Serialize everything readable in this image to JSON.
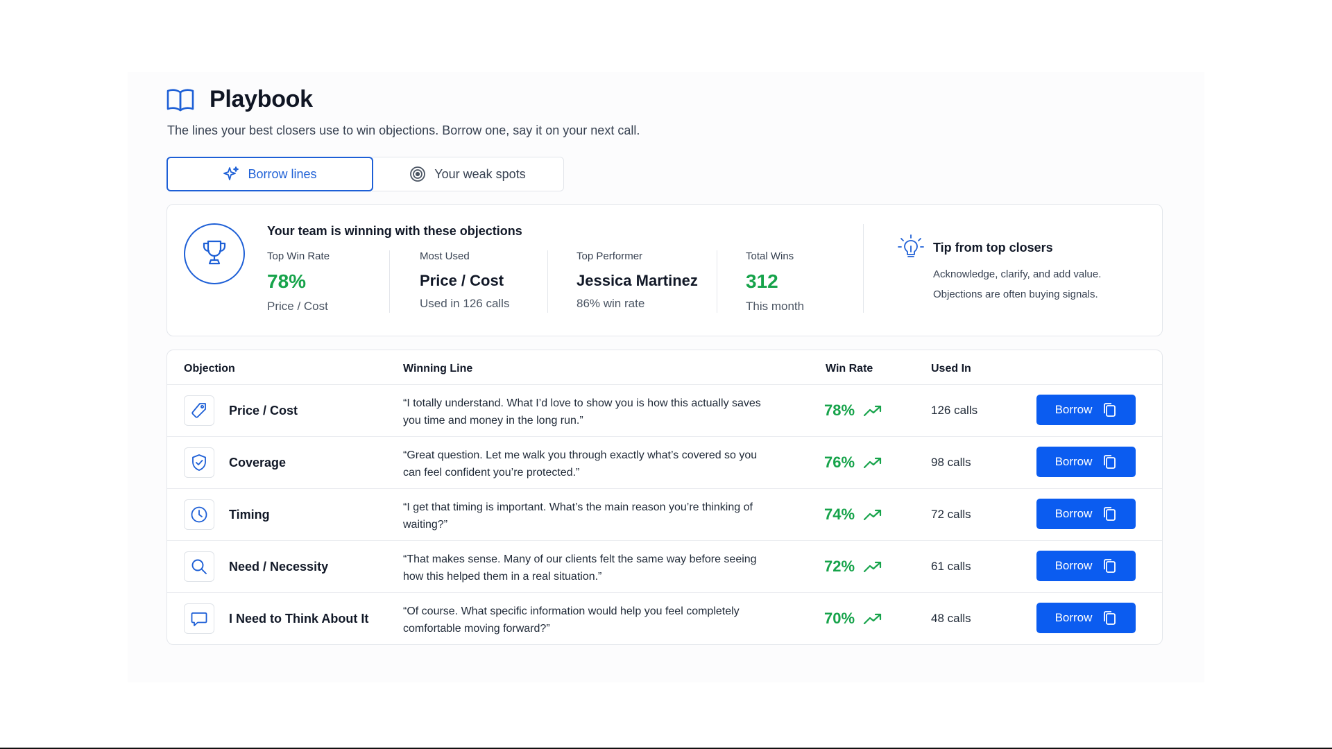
{
  "header": {
    "title": "Playbook",
    "icon": "book-open-icon",
    "subtitle": "The lines your best closers use to win objections. Borrow one, say it on your next call."
  },
  "tabs": [
    {
      "label": "Borrow lines",
      "icon": "sparkles-icon",
      "active": true
    },
    {
      "label": "Your weak spots",
      "icon": "target-icon",
      "active": false
    }
  ],
  "summary": {
    "title": "Your team is winning with these objections",
    "stats": [
      {
        "label": "Top Win Rate",
        "value": "78%",
        "sub": "Price / Cost"
      },
      {
        "label": "Most Used",
        "value": "Price / Cost",
        "sub": "Used in 126 calls"
      },
      {
        "label": "Top Performer",
        "value": "Jessica Martinez",
        "sub": "86% win rate"
      },
      {
        "label": "Total Wins",
        "value": "312",
        "sub": "This month"
      }
    ],
    "tip": {
      "title": "Tip from top closers",
      "lines": [
        "Acknowledge, clarify, and add value.",
        "Objections are often buying signals."
      ]
    }
  },
  "table": {
    "headers": {
      "objection": "Objection",
      "line": "Winning Line",
      "rate": "Win Rate",
      "used": "Used In"
    },
    "rows": [
      {
        "icon": "tag-icon",
        "objection": "Price / Cost",
        "line": "“I totally understand. What I’d love to show you is how this actually saves you time and money in the long run.”",
        "rate": "78%",
        "used": "126 calls",
        "action": "Borrow"
      },
      {
        "icon": "shield-check-icon",
        "objection": "Coverage",
        "line": "“Great question. Let me walk you through exactly what’s covered so you can feel confident you’re protected.”",
        "rate": "76%",
        "used": "98 calls",
        "action": "Borrow"
      },
      {
        "icon": "clock-icon",
        "objection": "Timing",
        "line": "“I get that timing is important. What’s the main reason you’re thinking of waiting?”",
        "rate": "74%",
        "used": "72 calls",
        "action": "Borrow"
      },
      {
        "icon": "search-icon",
        "objection": "Need / Necessity",
        "line": "“That makes sense. Many of our clients felt the same way before seeing how this helped them in a real situation.”",
        "rate": "72%",
        "used": "61 calls",
        "action": "Borrow"
      },
      {
        "icon": "chat-bubble-icon",
        "objection": "I Need to Think About It",
        "line": "“Of course. What specific information would help you feel completely comfortable moving forward?”",
        "rate": "70%",
        "used": "48 calls",
        "action": "Borrow"
      }
    ]
  },
  "colors": {
    "accent": "#1d5fd6",
    "button": "#0b5cf0",
    "success": "#16a34a",
    "border": "#e3e6eb"
  }
}
